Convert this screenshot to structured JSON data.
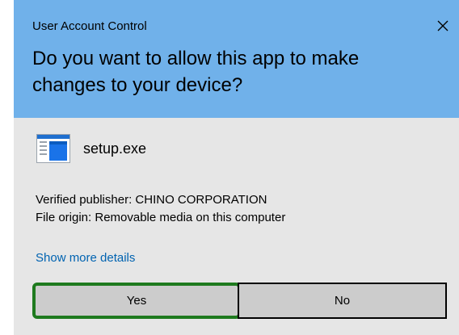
{
  "dialog": {
    "window_title": "User Account Control",
    "question": "Do you want to allow this app to make changes to your device?",
    "app_name": "setup.exe",
    "publisher_line": "Verified publisher: CHINO CORPORATION",
    "origin_line": "File origin: Removable media on this computer",
    "more_details": "Show more details",
    "yes_label": "Yes",
    "no_label": "No"
  },
  "colors": {
    "header": "#70b1ea",
    "body": "#e6e6e6",
    "link": "#0063b1",
    "yes_highlight": "#1e7a1e",
    "button": "#cccccc"
  },
  "icons": {
    "close": "close-icon",
    "app": "app-window-icon"
  }
}
